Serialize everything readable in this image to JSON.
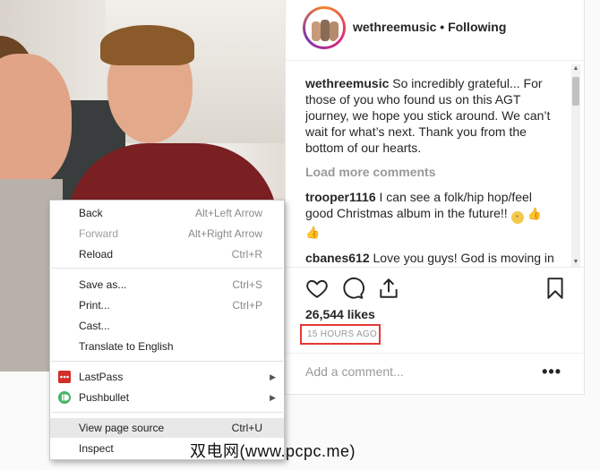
{
  "post": {
    "account": "wethreemusic",
    "separator": "•",
    "follow_state": "Following",
    "caption_user": "wethreemusic",
    "caption_text": " So incredibly grateful... For those of you who found us on this AGT journey, we hope you stick around. We can’t wait for what’s next. Thank you from the bottom of our hearts.",
    "load_more": "Load more comments",
    "comments": [
      {
        "user": "trooper1116",
        "text": " I can see a folk/hip hop/feel good Christmas album in the future!!"
      },
      {
        "user": "cbanes612",
        "text": " Love you guys! God is moving in your life’s and He has great things in"
      }
    ],
    "likes": "26,544 likes",
    "timestamp": "15 HOURS AGO",
    "comment_placeholder": "Add a comment...",
    "more_options": "•••"
  },
  "context_menu": {
    "items": [
      {
        "label": "Back",
        "shortcut": "Alt+Left Arrow"
      },
      {
        "label": "Forward",
        "shortcut": "Alt+Right Arrow"
      },
      {
        "label": "Reload",
        "shortcut": "Ctrl+R"
      },
      {
        "label": "Save as...",
        "shortcut": "Ctrl+S"
      },
      {
        "label": "Print...",
        "shortcut": "Ctrl+P"
      },
      {
        "label": "Cast..."
      },
      {
        "label": "Translate to English"
      },
      {
        "label": "LastPass",
        "icon": "lastpass-icon"
      },
      {
        "label": "Pushbullet",
        "icon": "pushbullet-icon"
      },
      {
        "label": "View page source",
        "shortcut": "Ctrl+U"
      },
      {
        "label": "Inspect"
      }
    ]
  },
  "watermark": "双电网(www.pcpc.me)",
  "colors": {
    "highlight_box": "#e53935",
    "lastpass": "#d32d27",
    "pushbullet": "#4ab367"
  }
}
